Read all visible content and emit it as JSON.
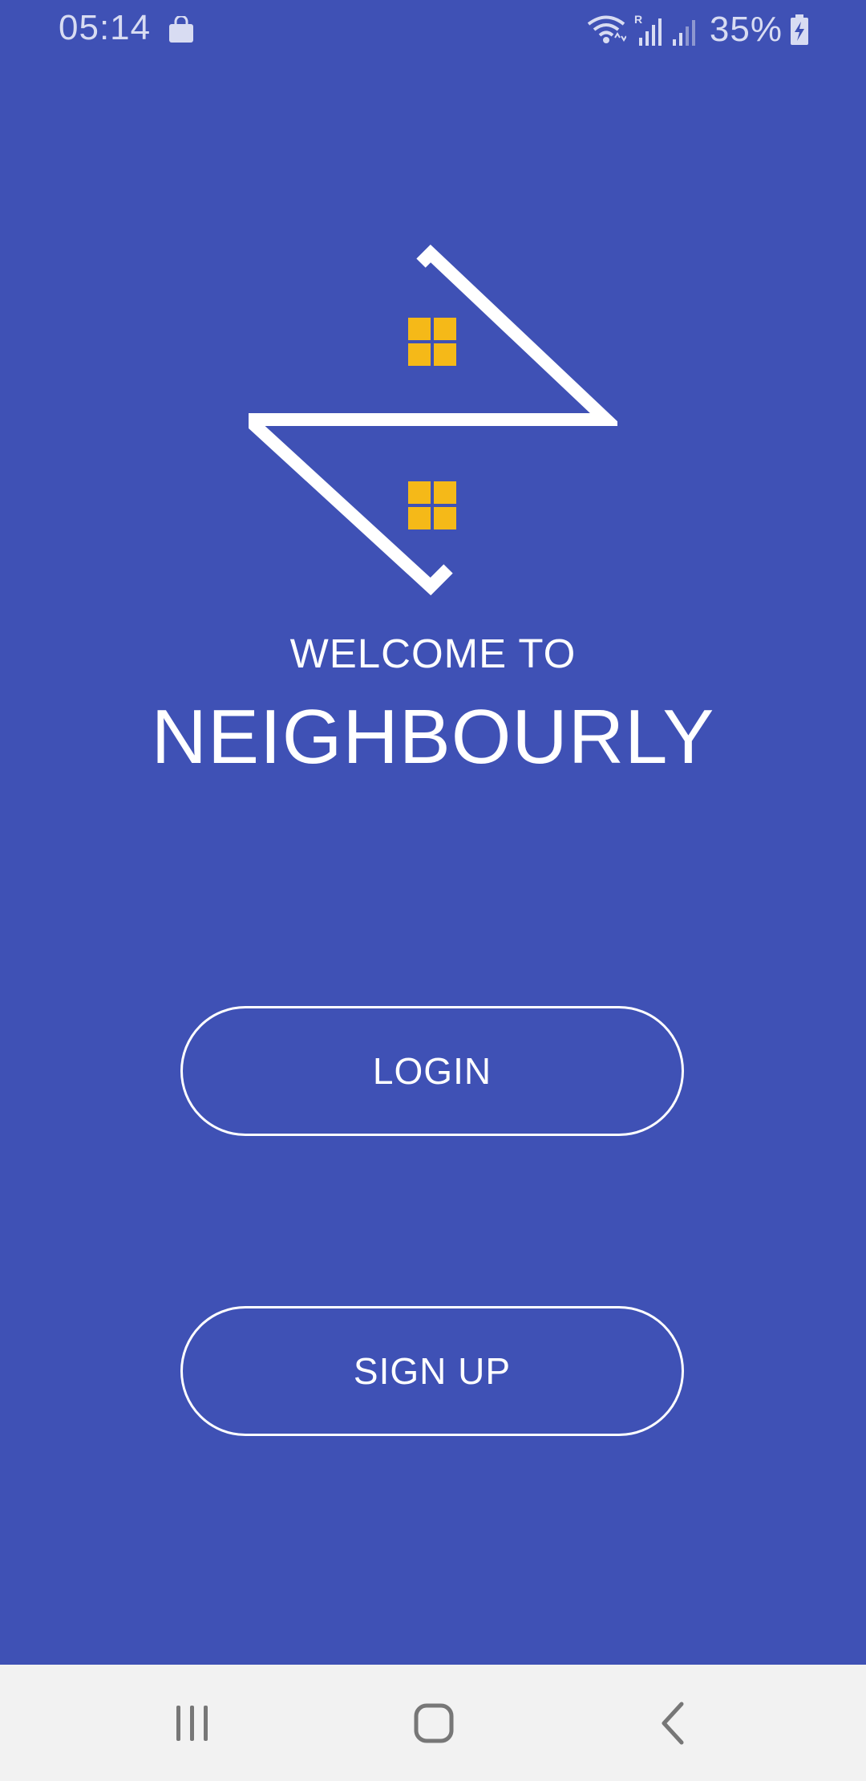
{
  "status_bar": {
    "time": "05:14",
    "battery": "35%",
    "icons": [
      "shopping-bag-icon",
      "wifi-icon",
      "signal-roaming-icon",
      "signal-icon",
      "battery-charging-icon"
    ]
  },
  "logo": {
    "line_color": "#ffffff",
    "window_color": "#f5b918"
  },
  "welcome_text": "WELCOME TO",
  "app_name": "NEIGHBOURLY",
  "buttons": {
    "login": "LOGIN",
    "signup": "SIGN UP"
  },
  "nav_bar": {
    "icons": [
      "recent-apps-icon",
      "home-icon",
      "back-icon"
    ]
  },
  "colors": {
    "background": "#3f51b5",
    "nav_background": "#f2f2f2"
  }
}
